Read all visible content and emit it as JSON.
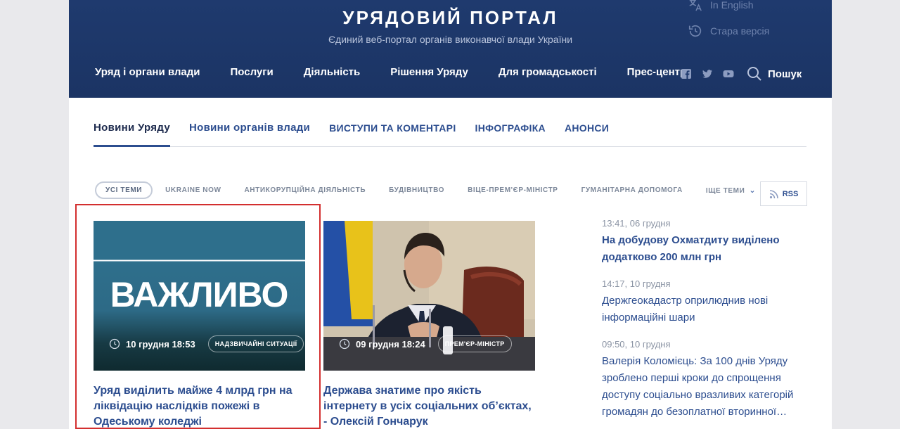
{
  "header": {
    "title": "Урядовий портал",
    "subtitle": "Єдиний веб-портал органів виконавчої влади України",
    "english_link": "In English",
    "old_version_link": "Стара версія",
    "search_label": "Пошук"
  },
  "nav": [
    "Уряд і органи влади",
    "Послуги",
    "Діяльність",
    "Рішення Уряду",
    "Для громадськості",
    "Прес-центр"
  ],
  "social_icons": [
    "facebook-icon",
    "twitter-icon",
    "youtube-icon"
  ],
  "tabs": [
    {
      "label": "Новини Уряду",
      "active": true
    },
    {
      "label": "Новини органів влади",
      "active": false
    },
    {
      "label": "Виступи та коментарі",
      "active": false
    },
    {
      "label": "Інфографіка",
      "active": false
    },
    {
      "label": "Анонси",
      "active": false
    }
  ],
  "topics": [
    "Усі теми",
    "Ukraine now",
    "Антикорупційна діяльність",
    "Будівництво",
    "Віце-прем'єр-міністр",
    "Гуманітарна допомога",
    "Іще теми"
  ],
  "rss_label": "RSS",
  "cards": [
    {
      "image_text": "ВАЖЛИВО",
      "date": "10 грудня 18:53",
      "tag": "Надзвичайні ситуації",
      "title": "Уряд виділить майже 4 млрд грн на ліквідацію наслідків пожежі в Одеському коледжі"
    },
    {
      "image_text": "",
      "date": "09 грудня 18:24",
      "tag": "Прем'єр-міністр",
      "title": "Держава знатиме про якість інтернету в усіх соціальних об’єктах, - Олексій Гончарук"
    }
  ],
  "feed": [
    {
      "time": "13:41, 06 грудня",
      "title": "На добудову Охматдиту виділено додатково 200 млн грн",
      "bold": true
    },
    {
      "time": "14:17, 10 грудня",
      "title": "Держгеокадастр оприлюднив нові інформаційні шари",
      "bold": false
    },
    {
      "time": "09:50, 10 грудня",
      "title": "Валерія Коломієць: За 100 днів Уряду зроблено перші кроки до спрощення доступу соціально вразливих категорій громадян до безоплатної вторинної…",
      "bold": false
    }
  ],
  "colors": {
    "header_bg": "#1f3a6e",
    "link": "#2c4d8f",
    "highlight": "#d32f2f"
  }
}
